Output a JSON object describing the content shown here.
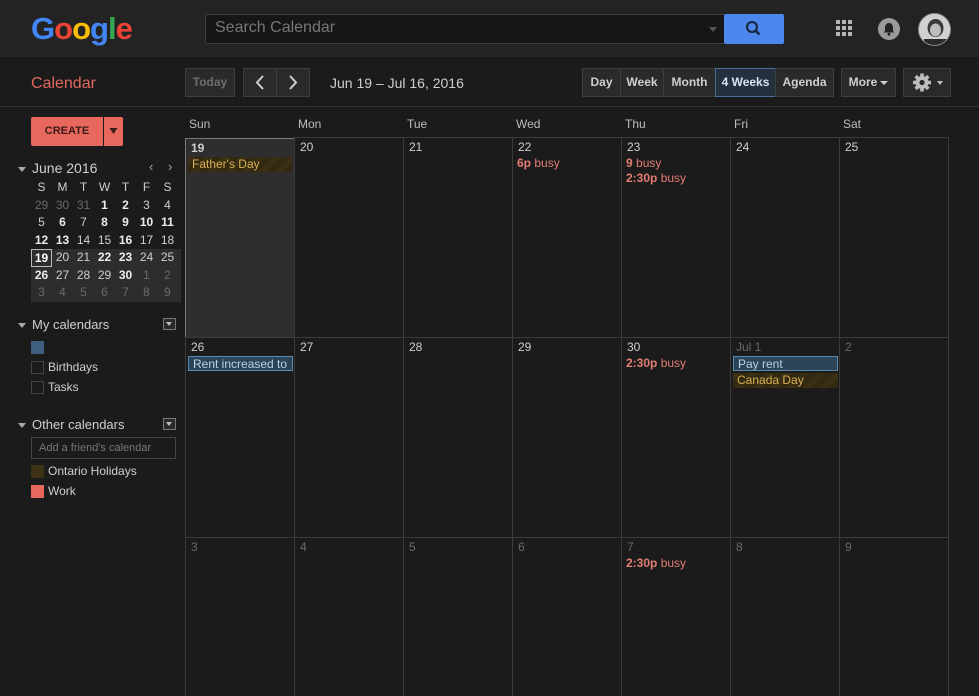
{
  "header": {
    "logo_letters": [
      "G",
      "o",
      "o",
      "g",
      "l",
      "e"
    ],
    "logo_colors": [
      "#4285f4",
      "#ea4335",
      "#fbbc05",
      "#4285f4",
      "#34a853",
      "#ea4335"
    ],
    "search_placeholder": "Search Calendar"
  },
  "toolbar": {
    "app_title": "Calendar",
    "today_label": "Today",
    "prev_label": "‹",
    "next_label": "›",
    "date_range": "Jun 19 – Jul 16, 2016",
    "views": [
      "Day",
      "Week",
      "Month",
      "4 Weeks",
      "Agenda"
    ],
    "active_view": "4 Weeks",
    "more_label": "More"
  },
  "sidebar": {
    "create_label": "CREATE",
    "mini_month": "June 2016",
    "mini_dow": [
      "S",
      "M",
      "T",
      "W",
      "T",
      "F",
      "S"
    ],
    "mini_weeks": [
      [
        "29",
        "30",
        "31",
        "1",
        "2",
        "3",
        "4"
      ],
      [
        "5",
        "6",
        "7",
        "8",
        "9",
        "10",
        "11"
      ],
      [
        "12",
        "13",
        "14",
        "15",
        "16",
        "17",
        "18"
      ],
      [
        "19",
        "20",
        "21",
        "22",
        "23",
        "24",
        "25"
      ],
      [
        "26",
        "27",
        "28",
        "29",
        "30",
        "1",
        "2"
      ],
      [
        "3",
        "4",
        "5",
        "6",
        "7",
        "8",
        "9"
      ]
    ],
    "my_calendars_label": "My calendars",
    "my_calendars": [
      {
        "label": "",
        "color": "#3e5f80"
      },
      {
        "label": "Birthdays",
        "color": ""
      },
      {
        "label": "Tasks",
        "color": ""
      }
    ],
    "other_calendars_label": "Other calendars",
    "friend_placeholder": "Add a friend's calendar",
    "other_calendars": [
      {
        "label": "Ontario Holidays",
        "color": "#3d3214"
      },
      {
        "label": "Work",
        "color": "#e8685d"
      }
    ]
  },
  "calendar": {
    "dow": [
      "Sun",
      "Mon",
      "Tue",
      "Wed",
      "Thu",
      "Fri",
      "Sat"
    ],
    "weeks": [
      {
        "days": [
          {
            "num": "19",
            "today": true,
            "bold": true
          },
          {
            "num": "20"
          },
          {
            "num": "21"
          },
          {
            "num": "22"
          },
          {
            "num": "23"
          },
          {
            "num": "24"
          },
          {
            "num": "25"
          }
        ]
      },
      {
        "days": [
          {
            "num": "26"
          },
          {
            "num": "27"
          },
          {
            "num": "28"
          },
          {
            "num": "29"
          },
          {
            "num": "30"
          },
          {
            "num": "Jul 1",
            "out": true
          },
          {
            "num": "2",
            "out": true
          }
        ]
      },
      {
        "days": [
          {
            "num": "3",
            "out": true
          },
          {
            "num": "4",
            "out": true
          },
          {
            "num": "5",
            "out": true
          },
          {
            "num": "6",
            "out": true
          },
          {
            "num": "7",
            "out": true
          },
          {
            "num": "8",
            "out": true
          },
          {
            "num": "9",
            "out": true
          }
        ]
      }
    ],
    "events": {
      "fathers_day": "Father's Day",
      "wed22": {
        "time": "6p",
        "text": " busy"
      },
      "thu23a": {
        "time": "9",
        "text": " busy"
      },
      "thu23b": {
        "time": "2:30p",
        "text": " busy"
      },
      "rent_increase": "Rent increased to",
      "thu30": {
        "time": "2:30p",
        "text": " busy"
      },
      "pay_rent": "Pay rent",
      "canada_day": "Canada Day",
      "thu7": {
        "time": "2:30p",
        "text": " busy"
      }
    }
  }
}
